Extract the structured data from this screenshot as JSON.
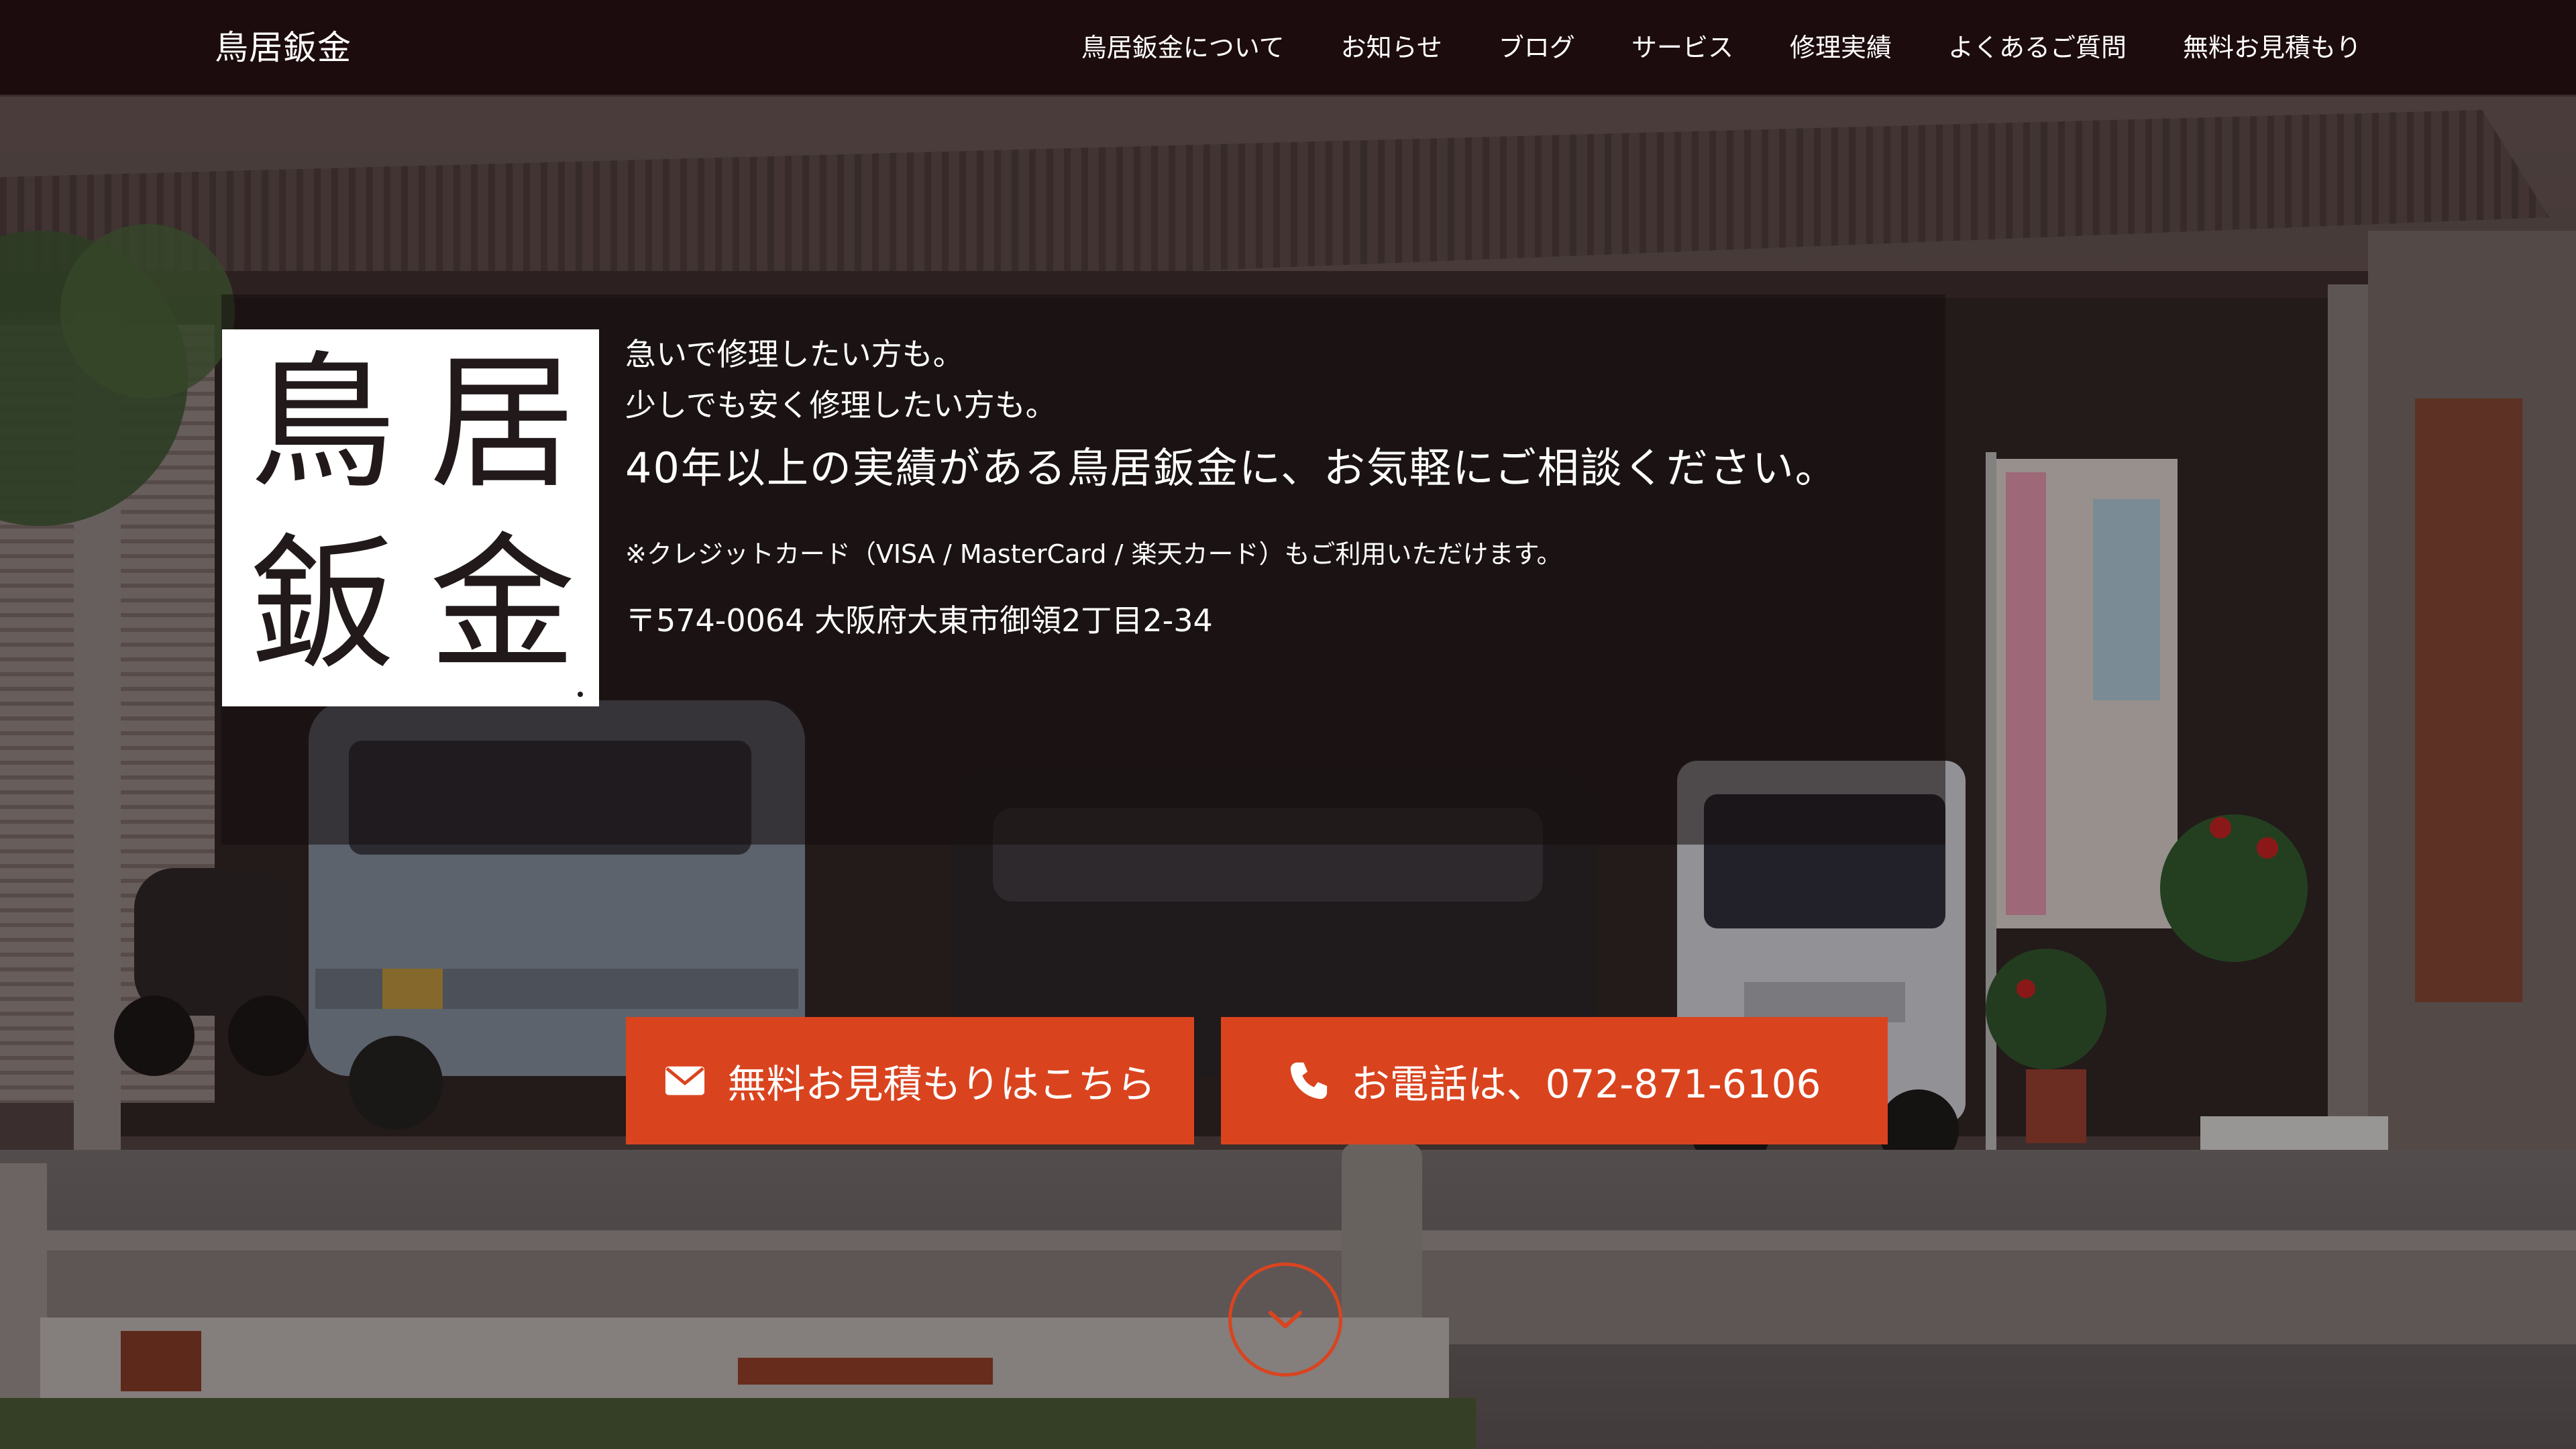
{
  "header": {
    "brand": "鳥居鈑金",
    "nav": [
      {
        "label": "鳥居鈑金について"
      },
      {
        "label": "お知らせ"
      },
      {
        "label": "ブログ"
      },
      {
        "label": "サービス"
      },
      {
        "label": "修理実績"
      },
      {
        "label": "よくあるご質問"
      },
      {
        "label": "無料お見積もり"
      }
    ]
  },
  "logo": {
    "chars": [
      "鳥",
      "居",
      "鈑",
      "金"
    ]
  },
  "hero": {
    "lead_lines": [
      "急いで修理したい方も。",
      "少しでも安く修理したい方も。"
    ],
    "headline": "40年以上の実績がある鳥居鈑金に、お気軽にご相談ください。",
    "note": "※クレジットカード（VISA / MasterCard / 楽天カード）もご利用いただけます。",
    "address": "〒574-0064 大阪府大東市御領2丁目2-34"
  },
  "cta": {
    "quote_label": "無料お見積もりはこちら",
    "quote_icon": "envelope-icon",
    "phone_label": "お電話は、072-871-6106",
    "phone_icon": "phone-icon"
  },
  "scroll": {
    "icon": "chevron-down-icon"
  },
  "colors": {
    "header_bg": "#1d0c0d",
    "accent": "#d9441f",
    "text_light": "#ffffff"
  }
}
